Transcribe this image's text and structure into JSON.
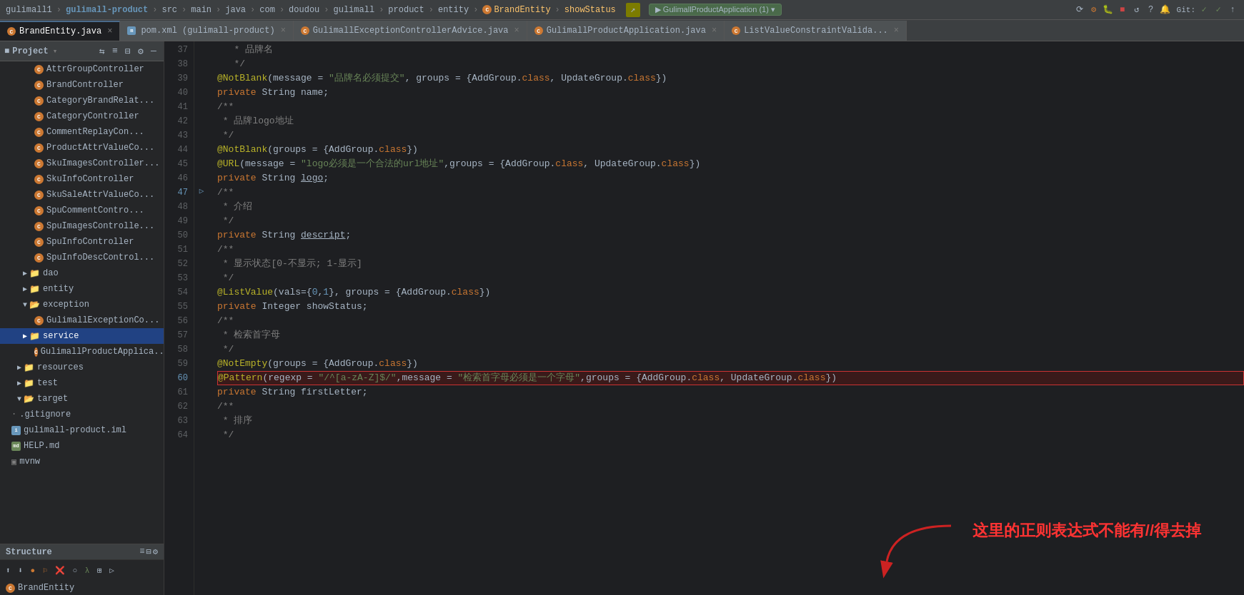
{
  "topbar": {
    "breadcrumbs": [
      "gulimall1",
      "gulimall-product",
      "src",
      "main",
      "java",
      "com",
      "doudou",
      "gulimall",
      "product",
      "entity",
      "BrandEntity",
      "showStatus"
    ],
    "run_config": "GulimallProductApplication (1)",
    "git_label": "Git:"
  },
  "tabs": [
    {
      "id": "brand-entity",
      "label": "BrandEntity.java",
      "active": true,
      "icon": "orange"
    },
    {
      "id": "pom-xml",
      "label": "pom.xml (gulimall-product)",
      "active": false,
      "icon": "gray"
    },
    {
      "id": "exception-advice",
      "label": "GulimallExceptionControllerAdvice.java",
      "active": false,
      "icon": "orange"
    },
    {
      "id": "application-java",
      "label": "GulimallProductApplication.java",
      "active": false,
      "icon": "orange"
    },
    {
      "id": "list-value",
      "label": "ListValueConstraintValida...",
      "active": false,
      "icon": "orange"
    }
  ],
  "sidebar": {
    "title": "Project",
    "tree_items": [
      {
        "id": "attr-group-controller",
        "label": "AttrGroupController",
        "indent": 48,
        "type": "java-c"
      },
      {
        "id": "brand-controller",
        "label": "BrandController",
        "indent": 48,
        "type": "java-c"
      },
      {
        "id": "category-brand-relat",
        "label": "CategoryBrandRelat...",
        "indent": 48,
        "type": "java-c"
      },
      {
        "id": "category-controller",
        "label": "CategoryController",
        "indent": 48,
        "type": "java-c"
      },
      {
        "id": "comment-replay-con",
        "label": "CommentReplayCon...",
        "indent": 48,
        "type": "java-c"
      },
      {
        "id": "product-attr-value-co",
        "label": "ProductAttrValueCo...",
        "indent": 48,
        "type": "java-c"
      },
      {
        "id": "sku-images-controller",
        "label": "SkuImagesController...",
        "indent": 48,
        "type": "java-c"
      },
      {
        "id": "sku-info-controller",
        "label": "SkuInfoController",
        "indent": 48,
        "type": "java-c"
      },
      {
        "id": "sku-sale-attr-value-co",
        "label": "SkuSaleAttrValueCo...",
        "indent": 48,
        "type": "java-c"
      },
      {
        "id": "spu-comment-contro",
        "label": "SpuCommentContro...",
        "indent": 48,
        "type": "java-c"
      },
      {
        "id": "spu-images-controlle",
        "label": "SpuImagesControlle...",
        "indent": 48,
        "type": "java-c"
      },
      {
        "id": "spu-info-controller",
        "label": "SpuInfoController",
        "indent": 48,
        "type": "java-c"
      },
      {
        "id": "spu-info-desc-control",
        "label": "SpuInfoDescControl...",
        "indent": 48,
        "type": "java-c"
      },
      {
        "id": "dao-folder",
        "label": "dao",
        "indent": 32,
        "type": "folder-closed"
      },
      {
        "id": "entity-folder",
        "label": "entity",
        "indent": 32,
        "type": "folder-closed"
      },
      {
        "id": "exception-folder",
        "label": "exception",
        "indent": 32,
        "type": "folder-open"
      },
      {
        "id": "gulimall-exception-co",
        "label": "GulimallExceptionCo...",
        "indent": 48,
        "type": "java-c"
      },
      {
        "id": "service-folder",
        "label": "service",
        "indent": 32,
        "type": "folder-closed",
        "selected": true
      },
      {
        "id": "gulimall-product-app",
        "label": "GulimallProductApplica...",
        "indent": 48,
        "type": "java-c"
      },
      {
        "id": "resources-folder",
        "label": "resources",
        "indent": 24,
        "type": "folder-closed"
      },
      {
        "id": "test-folder",
        "label": "test",
        "indent": 24,
        "type": "folder-closed"
      },
      {
        "id": "target-folder",
        "label": "target",
        "indent": 24,
        "type": "folder-open"
      },
      {
        "id": "gitignore",
        "label": ".gitignore",
        "indent": 16,
        "type": "file"
      },
      {
        "id": "gulimall-product-iml",
        "label": "gulimall-product.iml",
        "indent": 16,
        "type": "iml"
      },
      {
        "id": "help-md",
        "label": "HELP.md",
        "indent": 16,
        "type": "md"
      },
      {
        "id": "mvnw",
        "label": "mvnw",
        "indent": 16,
        "type": "file"
      }
    ]
  },
  "code": {
    "lines": [
      {
        "num": 37,
        "content": "   * 品牌名",
        "type": "comment"
      },
      {
        "num": 38,
        "content": "   */",
        "type": "comment"
      },
      {
        "num": 39,
        "content": "@NotBlank(message = \"品牌名必须提交\", groups = {AddGroup.class, UpdateGroup.class})",
        "type": "annotation"
      },
      {
        "num": 40,
        "content": "private String name;",
        "type": "code"
      },
      {
        "num": 41,
        "content": "/**",
        "type": "comment"
      },
      {
        "num": 42,
        "content": " * 品牌logo地址",
        "type": "comment"
      },
      {
        "num": 43,
        "content": " */",
        "type": "comment"
      },
      {
        "num": 44,
        "content": "@NotBlank(groups = {AddGroup.class})",
        "type": "annotation"
      },
      {
        "num": 45,
        "content": "@URL(message = \"logo必须是一个合法的url地址\",groups = {AddGroup.class, UpdateGroup.class})",
        "type": "annotation"
      },
      {
        "num": 46,
        "content": "private String logo;",
        "type": "code"
      },
      {
        "num": 47,
        "content": "/**",
        "type": "comment"
      },
      {
        "num": 48,
        "content": " * 介绍",
        "type": "comment"
      },
      {
        "num": 49,
        "content": " */",
        "type": "comment"
      },
      {
        "num": 50,
        "content": "private String descript;",
        "type": "code"
      },
      {
        "num": 51,
        "content": "/**",
        "type": "comment"
      },
      {
        "num": 52,
        "content": " * 显示状态[0-不显示; 1-显示]",
        "type": "comment"
      },
      {
        "num": 53,
        "content": " */",
        "type": "comment"
      },
      {
        "num": 54,
        "content": "@ListValue(vals={0,1}, groups = {AddGroup.class})",
        "type": "annotation"
      },
      {
        "num": 55,
        "content": "private Integer showStatus;",
        "type": "code"
      },
      {
        "num": 56,
        "content": "/**",
        "type": "comment"
      },
      {
        "num": 57,
        "content": " * 检索首字母",
        "type": "comment"
      },
      {
        "num": 58,
        "content": " */",
        "type": "comment"
      },
      {
        "num": 59,
        "content": "@NotEmpty(groups = {AddGroup.class})",
        "type": "annotation"
      },
      {
        "num": 60,
        "content": "@Pattern(regexp = \"/^[a-zA-Z]$/\",message = \"检索首字母必须是一个字母\",groups = {AddGroup.class, UpdateGroup.class})",
        "type": "annotation-highlighted"
      },
      {
        "num": 61,
        "content": "private String firstLetter;",
        "type": "code"
      },
      {
        "num": 62,
        "content": "/**",
        "type": "comment"
      },
      {
        "num": 63,
        "content": " * 排序",
        "type": "comment"
      },
      {
        "num": 64,
        "content": " */",
        "type": "comment"
      }
    ],
    "annotation_text": "这里的正则表达式不能有//得去掉",
    "annotation_color": "#ff3333"
  },
  "structure_section": {
    "label": "Structure"
  },
  "bottom_item": "BrandEntity"
}
